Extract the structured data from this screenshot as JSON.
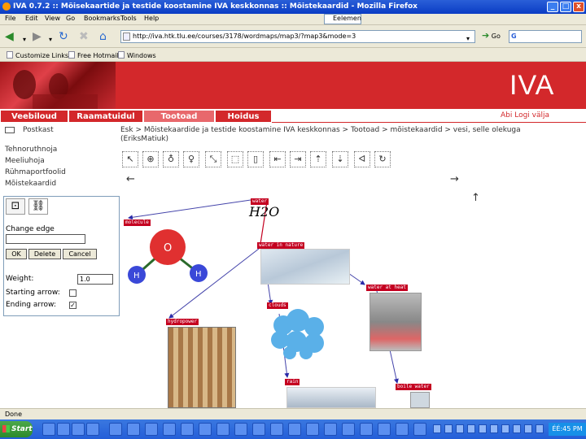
{
  "window": {
    "title": "IVA 0.7.2 :: Mõisekaartide ja testide koostamine IVA keskkonnas :: Mõistekaardid - Mozilla Firefox",
    "minimize_label": "_",
    "maximize_label": "□",
    "close_label": "x"
  },
  "menu": {
    "items": [
      "File",
      "Edit",
      "View",
      "Go",
      "Bookmarks",
      "Tools",
      "Help"
    ],
    "search_label": "Eelemen"
  },
  "nav": {
    "url": "http://iva.htk.tlu.ee/courses/3178/wordmaps/map3/?map3&mode=3",
    "go_label": "Go",
    "search_prefix": "G"
  },
  "bookmarks": [
    "Customize Links",
    "Free Hotmail",
    "Windows"
  ],
  "header": {
    "logo": "IVA",
    "accent_color": "#d3282b"
  },
  "tabs": [
    "Veebiloud",
    "Raamatuidul",
    "Tootoad",
    "Hoidus"
  ],
  "user_links": "Abi   Logi välja",
  "sidebar": {
    "mail_label": "Postkast",
    "links": [
      "Tehnoruthnoja",
      "Meeliuhoja",
      "Rühmaportfoolid",
      "Mõistekaardid"
    ],
    "panel": {
      "change_edge_label": "Change edge",
      "edge_value": "",
      "buttons": [
        "OK",
        "Delete",
        "Cancel"
      ],
      "weight_label": "Weight:",
      "weight_value": "1.0",
      "starting_arrow_label": "Starting arrow:",
      "ending_arrow_label": "Ending arrow:",
      "starting_arrow_checked": "",
      "ending_arrow_checked": "✓"
    }
  },
  "breadcrumb": {
    "line1": "Esk > Mõistekaardide ja testide koostamine IVA keskkonnas > Tootoad > mõistekaardid > vesi, selle olekuga",
    "line2": "(EriksMatiuk)"
  },
  "map_toolbar": {
    "icons": [
      "pointer-icon",
      "add-node-icon",
      "add-node-icon",
      "add-node-icon",
      "resize-icon",
      "box-icon",
      "box-icon",
      "arrow-left-icon",
      "arrow-right-icon",
      "arrow-up-icon",
      "arrow-down-icon",
      "undo-icon",
      "redo-icon"
    ],
    "arrow_left": "←",
    "arrow_right": "→",
    "arrow_up": "↑"
  },
  "map": {
    "nodes": [
      "water",
      "molecule",
      "water in nature",
      "water at heat",
      "hydropower",
      "clouds",
      "rain",
      "boile water"
    ],
    "formula": "H2O"
  },
  "status": "Done",
  "taskbar": {
    "start_label": "Start",
    "clock": "ÉÉ:45 PM"
  }
}
